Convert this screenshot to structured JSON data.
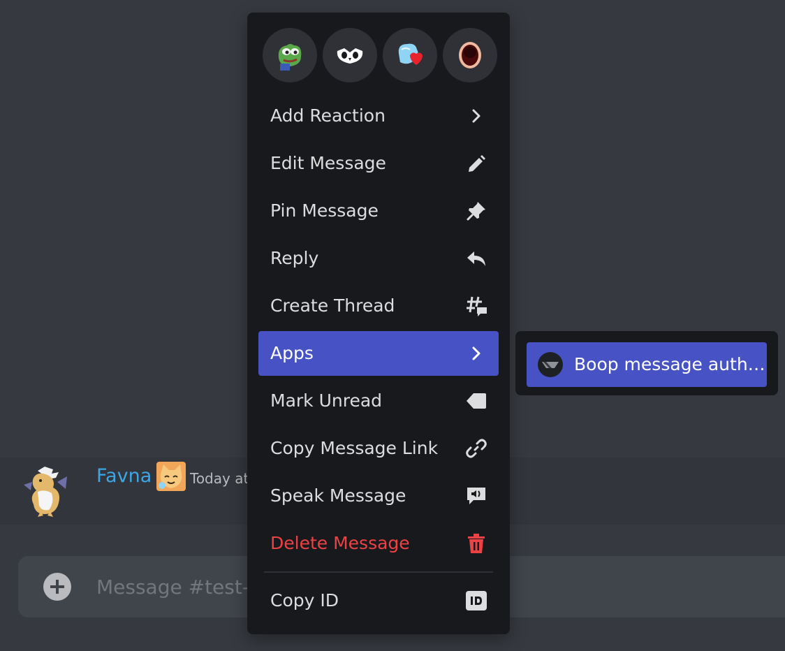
{
  "colors": {
    "background": "#36393f",
    "menu_background": "#18191c",
    "accent": "#4752c4",
    "danger": "#ed4245",
    "author": "#3ea6e3"
  },
  "message": {
    "author": "Favna",
    "timestamp": "Today at"
  },
  "composer": {
    "placeholder": "Message #test-m"
  },
  "context_menu": {
    "quick_reactions": [
      "pepe-emoji",
      "owl-emoji",
      "ice-heart-emoji",
      "gaping-mouth-emoji"
    ],
    "items": [
      {
        "label": "Add Reaction",
        "icon": "chevron-right-icon"
      },
      {
        "label": "Edit Message",
        "icon": "pencil-icon"
      },
      {
        "label": "Pin Message",
        "icon": "pin-icon"
      },
      {
        "label": "Reply",
        "icon": "reply-icon"
      },
      {
        "label": "Create Thread",
        "icon": "thread-icon"
      },
      {
        "label": "Apps",
        "icon": "chevron-right-icon",
        "active": true
      },
      {
        "label": "Mark Unread",
        "icon": "mark-unread-icon"
      },
      {
        "label": "Copy Message Link",
        "icon": "link-icon"
      },
      {
        "label": "Speak Message",
        "icon": "speak-icon"
      },
      {
        "label": "Delete Message",
        "icon": "trash-icon",
        "danger": true
      },
      {
        "label": "Copy ID",
        "icon": "id-icon"
      }
    ]
  },
  "apps_submenu": {
    "items": [
      {
        "label": "Boop message auth…",
        "icon": "app-avatar-icon"
      }
    ]
  }
}
